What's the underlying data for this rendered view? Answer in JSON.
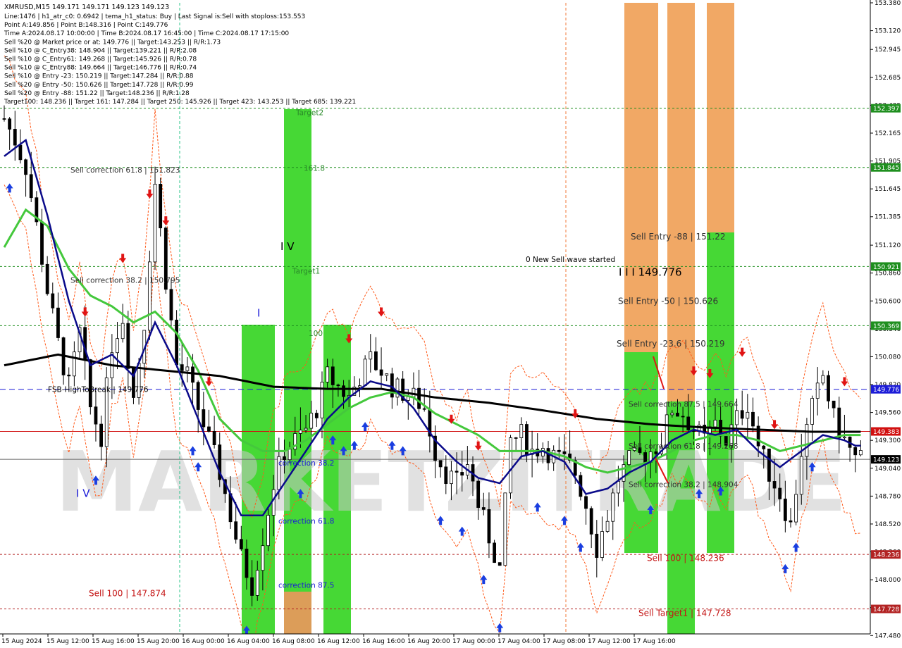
{
  "header": {
    "symbol_line": "XMRUSD,M15  149.171 149.171 149.123 149.123",
    "lines": [
      "Line:1476  |  h1_atr_c0: 0.6942  |  tema_h1_status: Buy  |  Last Signal is:Sell with stoploss:153.553",
      "Point A:149.856  |  Point B:148.316  |  Point C:149.776",
      "Time A:2024.08.17 10:00:00  |  Time B:2024.08.17 16:45:00  |  Time C:2024.08.17 17:15:00",
      "Sell %20 @ Market price or at: 149.776  ||  Target:143.253  ||  R/R:1.73",
      "Sell %10 @ C_Entry38: 148.904  ||  Target:139.221  ||  R/R:2.08",
      "Sell %10 @ C_Entry61: 149.268  ||  Target:145.926  ||  R/R:0.78",
      "Sell %10 @ C_Entry88: 149.664  ||  Target:146.776  ||  R/R:0.74",
      "Sell %10 @ Entry -23: 150.219  ||  Target:147.284  ||  R/R:0.88",
      "Sell %20 @ Entry -50: 150.626  ||  Target:147.728  ||  R/R:0.99",
      "Sell %20 @ Entry -88: 151.22  ||  Target:148.236  ||  R/R:1.28",
      "Target100: 148.236  ||  Target 161: 147.284  ||  Target 250: 145.926  ||  Target 423: 143.253  ||  Target 685: 139.221"
    ]
  },
  "watermark": "MARKETZITRADE",
  "colors": {
    "green_zone": "#3cd62a",
    "light_green_zone": "#74e43b",
    "orange_zone": "#e59a5c",
    "orange_light": "#f0a35d",
    "candle": "#000000",
    "ma_black": "#000000",
    "ma_navy": "#0a0a8a",
    "ma_green": "#44c83c",
    "envelope": "#ff5a1a",
    "hline_green": "#1f8f1f",
    "hline_blue": "#1c1cd8",
    "hline_red": "#d11010",
    "hline_brown": "#b22222",
    "label_red": "#c41414",
    "label_green_text": "#2a8a2a"
  },
  "chart_data": {
    "type": "candlestick",
    "symbol": "XMRUSD",
    "timeframe": "M15",
    "ylim": [
      147.495,
      153.38
    ],
    "y_ticks": [
      153.38,
      153.12,
      152.945,
      152.685,
      152.425,
      152.165,
      151.905,
      151.645,
      151.385,
      151.12,
      150.86,
      150.6,
      150.34,
      150.08,
      149.82,
      149.56,
      149.3,
      149.04,
      148.78,
      148.52,
      148.26,
      148.0,
      147.74,
      147.48
    ],
    "y_tick_labels": [
      "153.380",
      "153.120",
      "152.945",
      "152.685",
      "152.425",
      "152.165",
      "151.905",
      "151.645",
      "151.385",
      "151.120",
      "150.860",
      "150.600",
      "150.340",
      "150.080",
      "149.820",
      "149.560",
      "149.300",
      "149.040",
      "148.780",
      "148.520",
      "148.260",
      "148.000",
      "147.740",
      "147.480"
    ],
    "x_labels": [
      "15 Aug 2024",
      "15 Aug 12:00",
      "15 Aug 16:00",
      "15 Aug 20:00",
      "16 Aug 00:00",
      "16 Aug 04:00",
      "16 Aug 08:00",
      "16 Aug 12:00",
      "16 Aug 16:00",
      "16 Aug 20:00",
      "17 Aug 00:00",
      "17 Aug 04:00",
      "17 Aug 08:00",
      "17 Aug 12:00",
      "17 Aug 16:00"
    ],
    "price_badges": [
      {
        "value": 152.397,
        "label": "152.397",
        "kind": "green"
      },
      {
        "value": 151.845,
        "label": "151.845",
        "kind": "green"
      },
      {
        "value": 150.921,
        "label": "150.921",
        "kind": "green"
      },
      {
        "value": 150.369,
        "label": "150.369",
        "kind": "green"
      },
      {
        "value": 149.776,
        "label": "149.776",
        "kind": "blue"
      },
      {
        "value": 149.383,
        "label": "149.383",
        "kind": "red"
      },
      {
        "value": 149.123,
        "label": "149.123",
        "kind": "black"
      },
      {
        "value": 148.236,
        "label": "148.236",
        "kind": "brown"
      },
      {
        "value": 147.728,
        "label": "147.728",
        "kind": "brown"
      }
    ],
    "annotations": [
      {
        "text": "Sell correction 61.8 | 151.823",
        "price": 151.823,
        "color": "#333"
      },
      {
        "text": "Sell correction 38.2 | 150.795",
        "price": 150.795,
        "color": "#333"
      },
      {
        "text": "Sell 100 | 147.874",
        "price": 147.874,
        "color": "#c41414"
      },
      {
        "text": "Target2",
        "price": 152.36,
        "color": "#2a8a2a"
      },
      {
        "text": "161.8",
        "price": 151.84,
        "color": "#2a8a2a"
      },
      {
        "text": "Target1",
        "price": 150.88,
        "color": "#2a8a2a"
      },
      {
        "text": "100",
        "price": 150.3,
        "color": "#2a8a2a"
      },
      {
        "text": "correction 38.2",
        "price": 149.09,
        "color": "#1c1cd8"
      },
      {
        "text": "correction 61.8",
        "price": 148.55,
        "color": "#1c1cd8"
      },
      {
        "text": "correction 87.5",
        "price": 147.95,
        "color": "#1c1cd8"
      },
      {
        "text": "0 New Sell wave started",
        "price": 150.99,
        "color": "#000"
      },
      {
        "text": "I I I 149.776",
        "price": 150.86,
        "color": "#000"
      },
      {
        "text": "Sell Entry -88 | 151.22",
        "price": 151.2,
        "color": "#333"
      },
      {
        "text": "Sell Entry -50 | 150.626",
        "price": 150.6,
        "color": "#333"
      },
      {
        "text": "Sell Entry -23.6 | 150.219",
        "price": 150.2,
        "color": "#333"
      },
      {
        "text": "Sell correction 87.5 | 149.664",
        "price": 149.64,
        "color": "#333"
      },
      {
        "text": "Sell correction 61.8 | 149.268",
        "price": 149.25,
        "color": "#333"
      },
      {
        "text": "Sell correction 38.2 | 148.904",
        "price": 148.89,
        "color": "#333"
      },
      {
        "text": "Sell 100 | 148.236",
        "price": 148.2,
        "color": "#c41414"
      },
      {
        "text": "Sell Target1 | 147.728",
        "price": 147.69,
        "color": "#c41414"
      },
      {
        "text": "I V",
        "price": 151.1,
        "color": "#000"
      },
      {
        "text": "I",
        "price": 150.48,
        "color": "#1c1cd8"
      },
      {
        "text": "I V",
        "price": 148.8,
        "color": "#1c1cd8"
      },
      {
        "text": "FSB-HighToBreak | 149.776",
        "price": 149.776,
        "color": "#000"
      }
    ],
    "close_path": [
      [
        0,
        152.3
      ],
      [
        2,
        152.1
      ],
      [
        4,
        151.85
      ],
      [
        6,
        151.3
      ],
      [
        8,
        150.7
      ],
      [
        10,
        150.2
      ],
      [
        12,
        149.8
      ],
      [
        14,
        150.3
      ],
      [
        16,
        149.6
      ],
      [
        18,
        149.35
      ],
      [
        20,
        150.2
      ],
      [
        22,
        150.45
      ],
      [
        24,
        149.7
      ],
      [
        26,
        150.4
      ],
      [
        28,
        151.7
      ],
      [
        30,
        150.8
      ],
      [
        32,
        150.0
      ],
      [
        34,
        149.9
      ],
      [
        36,
        149.6
      ],
      [
        38,
        149.3
      ],
      [
        40,
        149.0
      ],
      [
        42,
        148.6
      ],
      [
        44,
        148.2
      ],
      [
        46,
        147.95
      ],
      [
        48,
        148.4
      ],
      [
        50,
        148.9
      ],
      [
        52,
        149.2
      ],
      [
        54,
        149.3
      ],
      [
        56,
        149.4
      ],
      [
        58,
        149.6
      ],
      [
        60,
        149.9
      ],
      [
        62,
        149.8
      ],
      [
        64,
        149.7
      ],
      [
        66,
        149.9
      ],
      [
        68,
        150.05
      ],
      [
        70,
        149.95
      ],
      [
        72,
        149.8
      ],
      [
        74,
        149.75
      ],
      [
        76,
        149.7
      ],
      [
        78,
        149.6
      ],
      [
        80,
        149.2
      ],
      [
        82,
        149.0
      ],
      [
        84,
        148.9
      ],
      [
        86,
        149.1
      ],
      [
        88,
        148.7
      ],
      [
        90,
        148.4
      ],
      [
        92,
        148.1
      ],
      [
        94,
        149.3
      ],
      [
        96,
        149.35
      ],
      [
        98,
        149.2
      ],
      [
        100,
        149.25
      ],
      [
        102,
        149.15
      ],
      [
        104,
        149.1
      ],
      [
        106,
        149.0
      ],
      [
        108,
        148.7
      ],
      [
        110,
        148.3
      ],
      [
        112,
        148.6
      ],
      [
        114,
        148.95
      ],
      [
        116,
        149.1
      ],
      [
        118,
        149.15
      ],
      [
        120,
        149.2
      ],
      [
        122,
        149.3
      ],
      [
        124,
        149.6
      ],
      [
        126,
        149.55
      ],
      [
        128,
        149.4
      ],
      [
        130,
        149.3
      ],
      [
        132,
        149.45
      ],
      [
        134,
        149.3
      ],
      [
        136,
        149.5
      ],
      [
        138,
        149.65
      ],
      [
        140,
        149.25
      ],
      [
        142,
        149.0
      ],
      [
        144,
        148.8
      ],
      [
        146,
        148.5
      ],
      [
        148,
        149.2
      ],
      [
        150,
        149.6
      ],
      [
        152,
        149.9
      ],
      [
        154,
        149.5
      ],
      [
        156,
        149.3
      ],
      [
        158,
        149.123
      ]
    ],
    "ma_black": [
      [
        0,
        150.0
      ],
      [
        10,
        150.1
      ],
      [
        20,
        150.0
      ],
      [
        30,
        149.95
      ],
      [
        40,
        149.9
      ],
      [
        50,
        149.8
      ],
      [
        60,
        149.78
      ],
      [
        70,
        149.78
      ],
      [
        80,
        149.7
      ],
      [
        90,
        149.65
      ],
      [
        100,
        149.58
      ],
      [
        110,
        149.5
      ],
      [
        120,
        149.45
      ],
      [
        130,
        149.42
      ],
      [
        140,
        149.4
      ],
      [
        150,
        149.38
      ],
      [
        158,
        149.38
      ]
    ],
    "ma_navy": [
      [
        0,
        151.95
      ],
      [
        4,
        152.1
      ],
      [
        8,
        151.4
      ],
      [
        12,
        150.6
      ],
      [
        16,
        150.0
      ],
      [
        20,
        150.1
      ],
      [
        24,
        149.9
      ],
      [
        28,
        150.4
      ],
      [
        32,
        150.0
      ],
      [
        36,
        149.5
      ],
      [
        40,
        149.0
      ],
      [
        44,
        148.6
      ],
      [
        48,
        148.6
      ],
      [
        52,
        148.9
      ],
      [
        56,
        149.2
      ],
      [
        60,
        149.5
      ],
      [
        64,
        149.7
      ],
      [
        68,
        149.85
      ],
      [
        72,
        149.8
      ],
      [
        76,
        149.6
      ],
      [
        80,
        149.3
      ],
      [
        84,
        149.1
      ],
      [
        88,
        148.95
      ],
      [
        92,
        148.9
      ],
      [
        96,
        149.15
      ],
      [
        100,
        149.2
      ],
      [
        104,
        149.1
      ],
      [
        108,
        148.8
      ],
      [
        112,
        148.85
      ],
      [
        116,
        149.0
      ],
      [
        120,
        149.1
      ],
      [
        124,
        149.3
      ],
      [
        128,
        149.4
      ],
      [
        132,
        149.35
      ],
      [
        136,
        149.4
      ],
      [
        140,
        149.2
      ],
      [
        144,
        149.05
      ],
      [
        148,
        149.2
      ],
      [
        152,
        149.35
      ],
      [
        156,
        149.3
      ],
      [
        158,
        149.25
      ]
    ],
    "ma_green": [
      [
        0,
        151.1
      ],
      [
        4,
        151.45
      ],
      [
        8,
        151.3
      ],
      [
        12,
        150.9
      ],
      [
        16,
        150.65
      ],
      [
        20,
        150.55
      ],
      [
        24,
        150.4
      ],
      [
        28,
        150.5
      ],
      [
        32,
        150.3
      ],
      [
        36,
        149.95
      ],
      [
        40,
        149.5
      ],
      [
        44,
        149.3
      ],
      [
        48,
        149.2
      ],
      [
        52,
        149.2
      ],
      [
        56,
        149.3
      ],
      [
        60,
        149.45
      ],
      [
        64,
        149.6
      ],
      [
        68,
        149.7
      ],
      [
        72,
        149.75
      ],
      [
        76,
        149.7
      ],
      [
        80,
        149.55
      ],
      [
        84,
        149.45
      ],
      [
        88,
        149.35
      ],
      [
        92,
        149.2
      ],
      [
        96,
        149.2
      ],
      [
        100,
        149.2
      ],
      [
        104,
        149.15
      ],
      [
        108,
        149.05
      ],
      [
        112,
        149.0
      ],
      [
        116,
        149.05
      ],
      [
        120,
        149.1
      ],
      [
        124,
        149.2
      ],
      [
        128,
        149.3
      ],
      [
        132,
        149.35
      ],
      [
        136,
        149.35
      ],
      [
        140,
        149.3
      ],
      [
        144,
        149.2
      ],
      [
        148,
        149.25
      ],
      [
        152,
        149.3
      ],
      [
        156,
        149.35
      ],
      [
        158,
        149.35
      ]
    ]
  }
}
